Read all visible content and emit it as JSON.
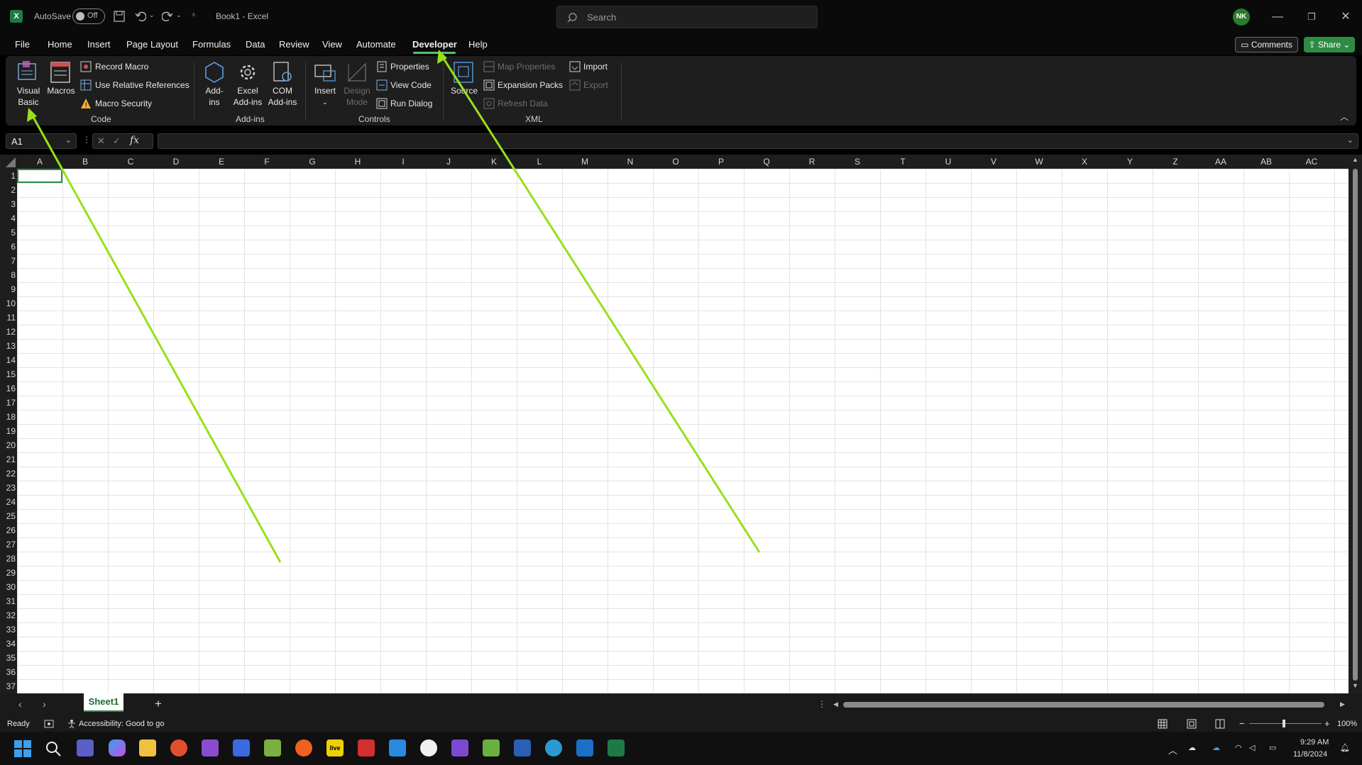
{
  "titlebar": {
    "autosave_label": "AutoSave",
    "autosave_state": "Off",
    "doc_title": "Book1 - Excel",
    "search_placeholder": "Search",
    "avatar_initials": "NK"
  },
  "menu": {
    "items": [
      "File",
      "Home",
      "Insert",
      "Page Layout",
      "Formulas",
      "Data",
      "Review",
      "View",
      "Automate",
      "Developer",
      "Help"
    ],
    "active": "Developer",
    "comments": "Comments",
    "share": "Share"
  },
  "ribbon": {
    "code": {
      "visual_basic": "Visual Basic",
      "macros": "Macros",
      "record_macro": "Record Macro",
      "use_relative": "Use Relative References",
      "macro_security": "Macro Security",
      "group": "Code"
    },
    "addins": {
      "addins": "Add-ins",
      "excel_addins": "Excel Add-ins",
      "com_addins": "COM Add-ins",
      "group": "Add-ins"
    },
    "controls": {
      "insert": "Insert",
      "design_mode": "Design Mode",
      "properties": "Properties",
      "view_code": "View Code",
      "run_dialog": "Run Dialog",
      "group": "Controls"
    },
    "xml": {
      "source": "Source",
      "map_properties": "Map Properties",
      "expansion_packs": "Expansion Packs",
      "refresh_data": "Refresh Data",
      "import": "Import",
      "export": "Export",
      "group": "XML"
    }
  },
  "formula_bar": {
    "name_box": "A1",
    "fx": "fx",
    "value": ""
  },
  "grid": {
    "columns": [
      "A",
      "B",
      "C",
      "D",
      "E",
      "F",
      "G",
      "H",
      "I",
      "J",
      "K",
      "L",
      "M",
      "N",
      "O",
      "P",
      "Q",
      "R",
      "S",
      "T",
      "U",
      "V",
      "W",
      "X",
      "Y",
      "Z",
      "AA",
      "AB",
      "AC"
    ],
    "rows": [
      "1",
      "2",
      "3",
      "4",
      "5",
      "6",
      "7",
      "8",
      "9",
      "10",
      "11",
      "12",
      "13",
      "14",
      "15",
      "16",
      "17",
      "18",
      "19",
      "20",
      "21",
      "22",
      "23",
      "24",
      "25",
      "26",
      "27",
      "28",
      "29",
      "30",
      "31",
      "32",
      "33",
      "34",
      "35",
      "36",
      "37"
    ]
  },
  "sheets": {
    "active": "Sheet1"
  },
  "status": {
    "ready": "Ready",
    "accessibility": "Accessibility: Good to go",
    "zoom": "100%"
  },
  "taskbar": {
    "time": "9:29 AM",
    "date": "11/8/2024",
    "live_label": "live"
  },
  "annotation_color": "#99e01a"
}
